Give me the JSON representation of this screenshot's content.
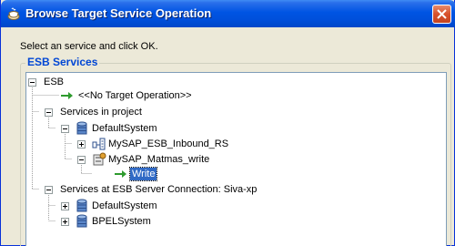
{
  "window": {
    "title": "Browse Target Service Operation"
  },
  "instruction": "Select an service and click OK.",
  "group": {
    "title": "ESB Services"
  },
  "tree": {
    "root": "ESB",
    "no_target": "<<No Target Operation>>",
    "services_in_project": "Services in project",
    "default_system": "DefaultSystem",
    "inbound_rs": "MySAP_ESB_Inbound_RS",
    "matmas_write": "MySAP_Matmas_write",
    "write": "Write",
    "services_at_server": "Services at ESB Server Connection: Siva-xp",
    "server_default_system": "DefaultSystem",
    "bpel_system": "BPELSystem"
  },
  "colors": {
    "titlebar": "#0054E3",
    "group_title": "#0046D5",
    "selection": "#316AC5",
    "operation_arrow": "#2E9B2E"
  },
  "icons": {
    "window": "app-cup-icon",
    "close": "close-icon",
    "operation": "green-arrow-icon",
    "folder": "folder-icon",
    "system": "database-icon",
    "inbound": "inbound-adapter-icon",
    "outbound": "outbound-adapter-icon"
  }
}
